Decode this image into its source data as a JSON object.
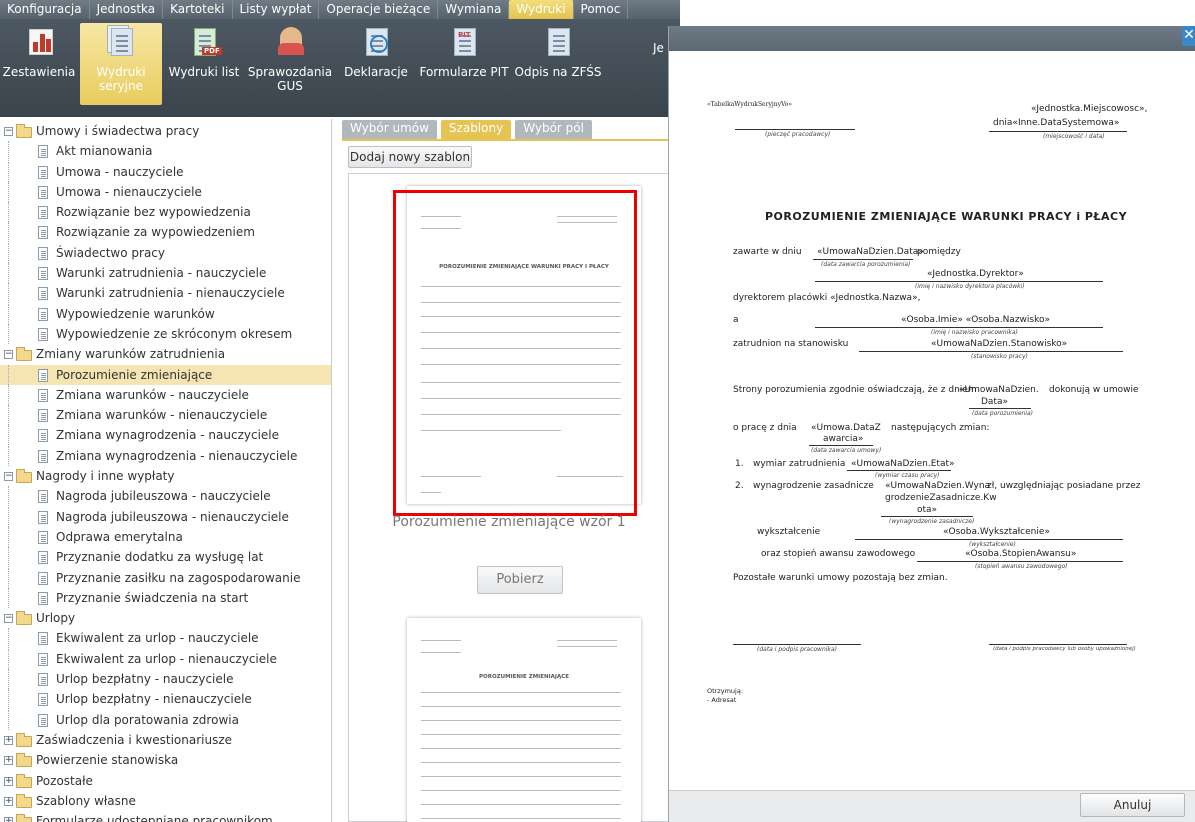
{
  "menubar": [
    "Konfiguracja",
    "Jednostka",
    "Kartoteki",
    "Listy wypłat",
    "Operacje bieżące",
    "Wymiana",
    "Wydruki",
    "Pomoc"
  ],
  "menubar_active": "Wydruki",
  "toolbar": {
    "zestawienia": "Zestawienia",
    "wydruki_seryjne_1": "Wydruki",
    "wydruki_seryjne_2": "seryjne",
    "wydruki_list": "Wydruki list",
    "pdf": "PDF",
    "sprawozdania_1": "Sprawozdania",
    "sprawozdania_2": "GUS",
    "deklaracje": "Deklaracje",
    "formularze_pit": "Formularze PIT",
    "pit": "PIT",
    "odpis": "Odpis na ZFŚS",
    "je": "Je"
  },
  "tree": [
    {
      "label": "Umowy i świadectwa pracy",
      "level": 0,
      "type": "folder",
      "state": "-"
    },
    {
      "label": "Akt mianowania",
      "level": 1,
      "type": "doc"
    },
    {
      "label": "Umowa - nauczyciele",
      "level": 1,
      "type": "doc"
    },
    {
      "label": "Umowa - nienauczyciele",
      "level": 1,
      "type": "doc"
    },
    {
      "label": "Rozwiązanie bez wypowiedzenia",
      "level": 1,
      "type": "doc"
    },
    {
      "label": "Rozwiązanie za wypowiedzeniem",
      "level": 1,
      "type": "doc"
    },
    {
      "label": "Świadectwo pracy",
      "level": 1,
      "type": "doc"
    },
    {
      "label": "Warunki zatrudnienia - nauczyciele",
      "level": 1,
      "type": "doc"
    },
    {
      "label": "Warunki zatrudnienia - nienauczyciele",
      "level": 1,
      "type": "doc"
    },
    {
      "label": "Wypowiedzenie warunków",
      "level": 1,
      "type": "doc"
    },
    {
      "label": "Wypowiedzenie ze skróconym okresem",
      "level": 1,
      "type": "doc"
    },
    {
      "label": "Zmiany warunków zatrudnienia",
      "level": 0,
      "type": "folder",
      "state": "-"
    },
    {
      "label": "Porozumienie zmieniające",
      "level": 1,
      "type": "doc",
      "selected": true
    },
    {
      "label": "Zmiana warunków - nauczyciele",
      "level": 1,
      "type": "doc"
    },
    {
      "label": "Zmiana warunków - nienauczyciele",
      "level": 1,
      "type": "doc"
    },
    {
      "label": "Zmiana wynagrodzenia - nauczyciele",
      "level": 1,
      "type": "doc"
    },
    {
      "label": "Zmiana wynagrodzenia - nienauczyciele",
      "level": 1,
      "type": "doc"
    },
    {
      "label": "Nagrody i inne wypłaty",
      "level": 0,
      "type": "folder",
      "state": "-"
    },
    {
      "label": "Nagroda jubileuszowa - nauczyciele",
      "level": 1,
      "type": "doc"
    },
    {
      "label": "Nagroda jubileuszowa - nienauczyciele",
      "level": 1,
      "type": "doc"
    },
    {
      "label": "Odprawa emerytalna",
      "level": 1,
      "type": "doc"
    },
    {
      "label": "Przyznanie dodatku za wysługę lat",
      "level": 1,
      "type": "doc"
    },
    {
      "label": "Przyznanie zasiłku na zagospodarowanie",
      "level": 1,
      "type": "doc"
    },
    {
      "label": "Przyznanie świadczenia na start",
      "level": 1,
      "type": "doc"
    },
    {
      "label": "Urlopy",
      "level": 0,
      "type": "folder",
      "state": "-"
    },
    {
      "label": "Ekwiwalent za urlop - nauczyciele",
      "level": 1,
      "type": "doc"
    },
    {
      "label": "Ekwiwalent za urlop - nienauczyciele",
      "level": 1,
      "type": "doc"
    },
    {
      "label": "Urlop bezpłatny - nauczyciele",
      "level": 1,
      "type": "doc"
    },
    {
      "label": "Urlop bezpłatny - nienauczyciele",
      "level": 1,
      "type": "doc"
    },
    {
      "label": "Urlop dla poratowania zdrowia",
      "level": 1,
      "type": "doc"
    },
    {
      "label": "Zaświadczenia i kwestionariusze",
      "level": 0,
      "type": "folder",
      "state": "+"
    },
    {
      "label": "Powierzenie stanowiska",
      "level": 0,
      "type": "folder",
      "state": "+"
    },
    {
      "label": "Pozostałe",
      "level": 0,
      "type": "folder",
      "state": "+"
    },
    {
      "label": "Szablony własne",
      "level": 0,
      "type": "folder",
      "state": "+"
    },
    {
      "label": "Formularze udostępniane pracownikom",
      "level": 0,
      "type": "folder",
      "state": "+"
    }
  ],
  "tabs": [
    "Wybór umów",
    "Szablony",
    "Wybór pól"
  ],
  "tabs_active": "Szablony",
  "add_template_button": "Dodaj nowy szablon",
  "thumb_caption": "Porozumienie zmieniające wzór 1",
  "pobierz_button": "Pobierz",
  "thumb1": {
    "title": "POROZUMIENIE ZMIENIAJĄCE WARUNKI PRACY I PŁACY"
  },
  "thumb2": {
    "title": "POROZUMIENIE ZMIENIAJĄCE"
  },
  "document": {
    "stamp_field": "«TabelkaWydrukSeryjnyVo»",
    "stamp_caption": "(pieczęć pracodawcy)",
    "place_date_1": "«Jednostka.Miejscowosc»,",
    "place_date_2": "dnia«Inne.DataSystemowa»",
    "place_date_caption": "(miejscowość i data)",
    "title": "POROZUMIENIE ZMIENIAJĄCE WARUNKI PRACY i PŁACY",
    "zawarte": "zawarte w dniu",
    "zawarte_field": "«UmowaNaDzien.Data»",
    "pomiedzy": "pomiędzy",
    "zawarte_caption": "(data zawarcia porozumienia)",
    "dyrektor_field": "«Jednostka.Dyrektor»",
    "dyrektor_caption": "(imię i nazwisko dyrektora placówki)",
    "dyrektorem": "dyrektorem placówki «Jednostka.Nazwa»,",
    "a": "a",
    "osoba_field": "«Osoba.Imie» «Osoba.Nazwisko»",
    "osoba_caption": "(imię i nazwisko pracownika)",
    "zatrudnion": "zatrudnion na stanowisku",
    "stanowisko_field": "«UmowaNaDzien.Stanowisko»",
    "stanowisko_caption": "(stanowisko pracy)",
    "strony": "Strony porozumienia zgodnie oświadczają, że z dniem",
    "strony_field_1": "«UmowaNaDzien.",
    "strony_field_2": "Data»",
    "strony_tail": "dokonują w umowie",
    "strony_caption": "(data porozumienia)",
    "prace": "o pracę z dnia",
    "prace_field_1": "«Umowa.DataZ",
    "prace_field_2": "awarcia»",
    "prace_tail": "następujących zmian:",
    "prace_caption": "(data zawarcia umowy)",
    "item1_num": "1.",
    "item1": "wymiar zatrudnienia",
    "item1_field": "«UmowaNaDzien.Etat»",
    "item1_caption": "(wymiar czasu pracy)",
    "item2_num": "2.",
    "item2": "wynagrodzenie zasadnicze",
    "item2_field_1": "«UmowaNaDzien.Wyna",
    "item2_field_2": "grodzenieZasadnicze.Kw",
    "item2_field_3": "ota»",
    "item2_tail": "zł, uwzględniając posiadane przez",
    "item2_caption": "(wynagrodzenie zasadnicze)",
    "wyksztalcenie": "wykształcenie",
    "wyksztalcenie_field": "«Osoba.Wykształcenie»",
    "wyksztalcenie_caption": "(wykształcenie)",
    "stopien": "oraz stopień awansu zawodowego",
    "stopien_field": "«Osoba.StopienAwansu»",
    "stopien_caption": "(stopień awansu zawodowego)",
    "pozostale": "Pozostałe warunki umowy pozostają bez zmian.",
    "sig_left": "(data i podpis pracownika)",
    "sig_right": "(data i podpis pracodawcy lub osoby upoważnionej)",
    "otrzymuja": "Otrzymują:",
    "adresat": "- Adresat"
  },
  "anuluj_button": "Anuluj",
  "close_glyph": "✕"
}
